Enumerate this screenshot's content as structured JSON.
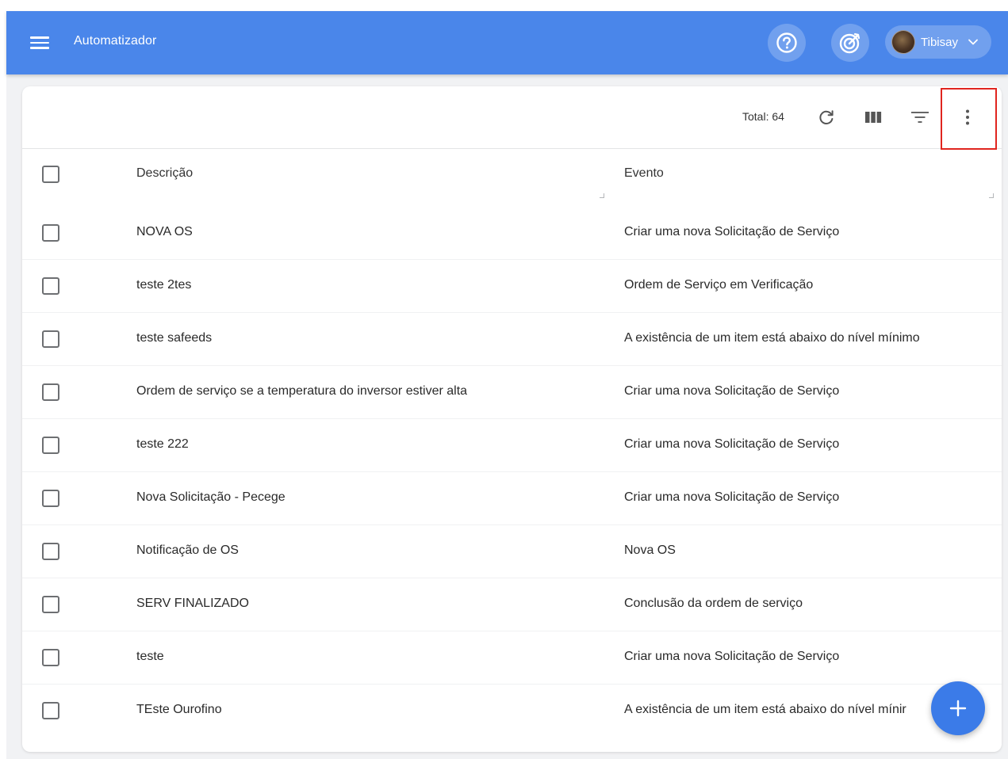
{
  "appbar": {
    "title": "Automatizador",
    "user": {
      "name": "Tibisay"
    },
    "icons": [
      "menu-icon",
      "help-icon",
      "target-icon",
      "chevron-down-icon"
    ]
  },
  "toolbar": {
    "total_label": "Total: 64",
    "icons": [
      "refresh-icon",
      "columns-icon",
      "filter-icon",
      "more-vert-icon"
    ]
  },
  "table": {
    "headers": {
      "description": "Descrição",
      "event": "Evento"
    },
    "rows": [
      {
        "description": "NOVA OS",
        "event": "Criar uma nova Solicitação de Serviço"
      },
      {
        "description": "teste 2tes",
        "event": "Ordem de Serviço em Verificação"
      },
      {
        "description": "teste safeeds",
        "event": "A existência de um item está abaixo do nível mínimo"
      },
      {
        "description": "Ordem de serviço se a temperatura do inversor estiver alta",
        "event": "Criar uma nova Solicitação de Serviço"
      },
      {
        "description": "teste 222",
        "event": "Criar uma nova Solicitação de Serviço"
      },
      {
        "description": "Nova Solicitação - Pecege",
        "event": "Criar uma nova Solicitação de Serviço"
      },
      {
        "description": "Notificação de OS",
        "event": "Nova OS"
      },
      {
        "description": "SERV FINALIZADO",
        "event": "Conclusão da ordem de serviço"
      },
      {
        "description": "teste",
        "event": "Criar uma nova Solicitação de Serviço"
      },
      {
        "description": "TEste Ourofino",
        "event": "A existência de um item está abaixo do nível mínir"
      }
    ]
  },
  "fab": {
    "icon": "plus-icon"
  },
  "colors": {
    "appbar": "#4a86ea",
    "fab": "#3b7be8",
    "highlight": "#e0251f"
  }
}
